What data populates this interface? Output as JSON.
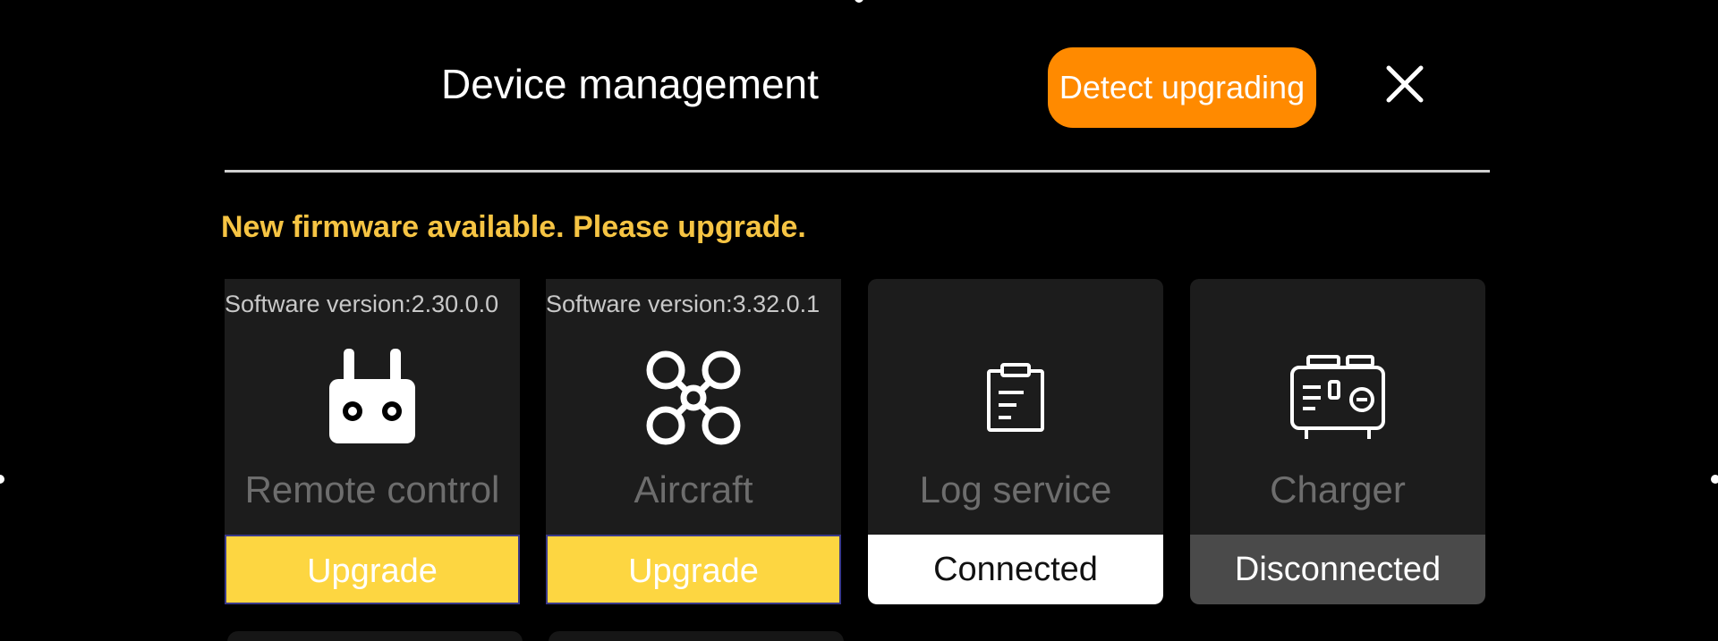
{
  "header": {
    "title": "Device management",
    "detect_button": "Detect upgrading"
  },
  "notice": "New firmware available. Please upgrade.",
  "devices": [
    {
      "version": "Software version:2.30.0.0",
      "name": "Remote control",
      "action": "Upgrade",
      "icon": "remote-controller-icon"
    },
    {
      "version": "Software version:3.32.0.1",
      "name": "Aircraft",
      "action": "Upgrade",
      "icon": "drone-icon"
    },
    {
      "version": "",
      "name": "Log service",
      "action": "Connected",
      "icon": "clipboard-icon"
    },
    {
      "version": "",
      "name": "Charger",
      "action": "Disconnected",
      "icon": "charger-generator-icon"
    }
  ],
  "colors": {
    "accent_orange": "#ff8a00",
    "notice_yellow": "#f6c443",
    "upgrade_yellow": "#fdd641",
    "card_bg": "#1c1c1c"
  }
}
